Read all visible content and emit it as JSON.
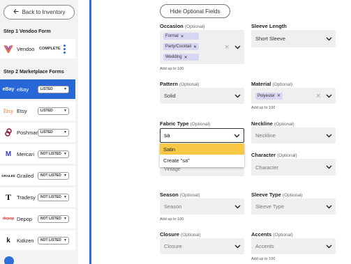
{
  "sidebar": {
    "back_label": "Back to Inventory",
    "step1": "Step 1 Vendoo Form",
    "vendoo": {
      "name": "Vendoo",
      "status": "COMPLETE"
    },
    "step2": "Step 2 Marketplace Forms",
    "marketplaces": [
      {
        "name": "eBay",
        "status": "LISTED",
        "logo": "eBay"
      },
      {
        "name": "Etsy",
        "status": "LISTED",
        "logo": "Etsy"
      },
      {
        "name": "Poshmark",
        "status": "LISTED",
        "logo": ""
      },
      {
        "name": "Mercari",
        "status": "NOT LISTED",
        "logo": "M"
      },
      {
        "name": "Grailed",
        "status": "NOT LISTED",
        "logo": "GRAILED"
      },
      {
        "name": "Tradesy",
        "status": "NOT LISTED",
        "logo": "T"
      },
      {
        "name": "Depop",
        "status": "NOT LISTED",
        "logo": "depop"
      },
      {
        "name": "Kidizen",
        "status": "NOT LISTED",
        "logo": "k"
      }
    ]
  },
  "form": {
    "hide_optional_label": "Hide Optional Fields",
    "optional_tag": "(Optional)",
    "add_up_to": "Add up to 100",
    "occasion": {
      "label": "Occasion",
      "chips": [
        "Formal",
        "Party/Cocktail",
        "Wedding"
      ]
    },
    "sleeve_length": {
      "label": "Sleeve Length",
      "value": "Short Sleeve"
    },
    "pattern": {
      "label": "Pattern",
      "value": "Solid"
    },
    "material": {
      "label": "Material",
      "chips": [
        "Polyester"
      ]
    },
    "fabric_type": {
      "label": "Fabric Type",
      "input": "sa",
      "options": [
        "Satin",
        "Create \"sa\""
      ],
      "hidden_value": "Vintage"
    },
    "neckline": {
      "label": "Neckline",
      "placeholder": "Neckline"
    },
    "character": {
      "label": "Character",
      "placeholder": "Character"
    },
    "season": {
      "label": "Season",
      "placeholder": "Season"
    },
    "sleeve_type": {
      "label": "Sleeve Type",
      "placeholder": "Sleeve Type"
    },
    "closure": {
      "label": "Closure",
      "placeholder": "Closure"
    },
    "accents": {
      "label": "Accents",
      "placeholder": "Accents"
    }
  },
  "colors": {
    "accent_blue": "#2867d8",
    "highlight": "#f6c845",
    "chip": "#d7d7f3"
  }
}
